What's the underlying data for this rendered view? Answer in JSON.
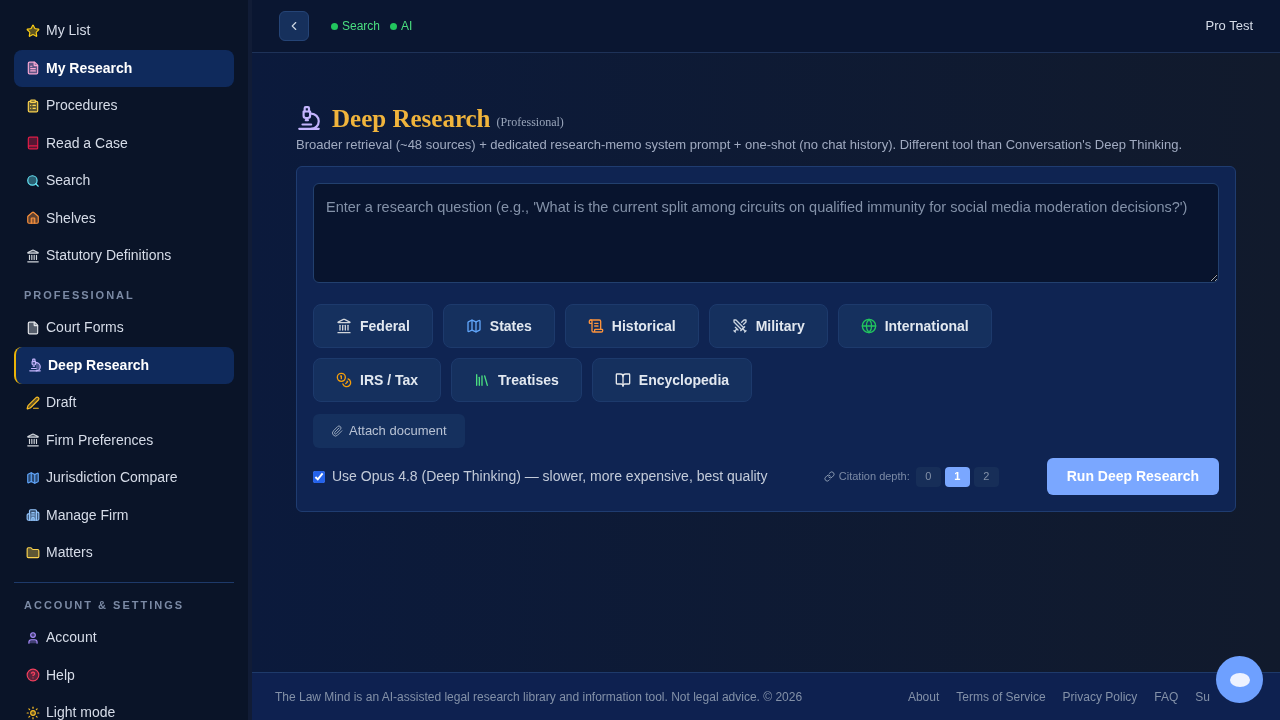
{
  "sidebar": {
    "sections": [
      {
        "items": [
          {
            "label": "My List",
            "selected": false,
            "highlighted": false
          },
          {
            "label": "My Research",
            "selected": false,
            "highlighted": true
          },
          {
            "label": "Procedures",
            "selected": false,
            "highlighted": false
          },
          {
            "label": "Read a Case",
            "selected": false,
            "highlighted": false
          },
          {
            "label": "Search",
            "selected": false,
            "highlighted": false
          },
          {
            "label": "Shelves",
            "selected": false,
            "highlighted": false
          },
          {
            "label": "Statutory Definitions",
            "selected": false,
            "highlighted": false
          }
        ]
      },
      {
        "heading": "PROFESSIONAL",
        "items": [
          {
            "label": "Court Forms",
            "selected": false,
            "highlighted": false
          },
          {
            "label": "Deep Research",
            "selected": true,
            "highlighted": true
          },
          {
            "label": "Draft",
            "selected": false,
            "highlighted": false
          },
          {
            "label": "Firm Preferences",
            "selected": false,
            "highlighted": false
          },
          {
            "label": "Jurisdiction Compare",
            "selected": false,
            "highlighted": false
          },
          {
            "label": "Manage Firm",
            "selected": false,
            "highlighted": false
          },
          {
            "label": "Matters",
            "selected": false,
            "highlighted": false
          }
        ]
      },
      {
        "heading": "ACCOUNT & SETTINGS",
        "items": [
          {
            "label": "Account",
            "selected": false,
            "highlighted": false
          },
          {
            "label": "Help",
            "selected": false,
            "highlighted": false
          },
          {
            "label": "Light mode",
            "selected": false,
            "highlighted": false
          }
        ]
      }
    ]
  },
  "header": {
    "status": [
      {
        "label": "Search",
        "on": true
      },
      {
        "label": "AI",
        "on": true
      }
    ],
    "user": "Pro Test"
  },
  "page": {
    "title": "Deep Research",
    "subtitle": "(Professional)",
    "description": "Broader retrieval (~48 sources) + dedicated research-memo system prompt + one-shot (no chat history). Different tool than Conversation's Deep Thinking."
  },
  "form": {
    "question": {
      "placeholder": "Enter a research question (e.g., 'What is the current split among circuits on qualified immunity for social media moderation decisions?')"
    },
    "sources": [
      {
        "label": "Federal"
      },
      {
        "label": "States"
      },
      {
        "label": "Historical"
      },
      {
        "label": "Military"
      },
      {
        "label": "International"
      },
      {
        "label": "IRS / Tax"
      },
      {
        "label": "Treatises"
      },
      {
        "label": "Encyclopedia"
      }
    ],
    "attach": "Attach document",
    "opus": {
      "label": "Use Opus 4.8 (Deep Thinking) — slower, more expensive, best quality",
      "checked": true
    },
    "citation_depth": {
      "label": "Citation depth:",
      "options": [
        {
          "label": "0",
          "selected": false
        },
        {
          "label": "1",
          "selected": true
        },
        {
          "label": "2",
          "selected": false
        }
      ]
    },
    "run": "Run Deep Research"
  },
  "footer": {
    "notice": "The Law Mind is an AI-assisted legal research library and information tool. Not legal advice. © 2026",
    "links": [
      "About",
      "Terms of Service",
      "Privacy Policy",
      "FAQ",
      "Su"
    ]
  }
}
